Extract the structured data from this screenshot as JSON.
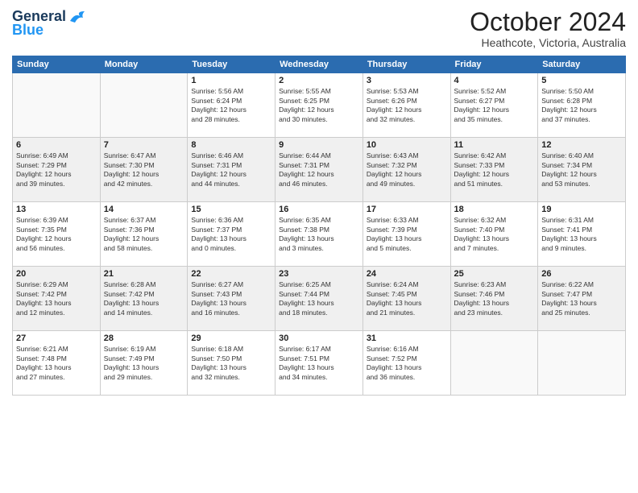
{
  "header": {
    "logo_general": "General",
    "logo_blue": "Blue",
    "month_title": "October 2024",
    "location": "Heathcote, Victoria, Australia"
  },
  "days_of_week": [
    "Sunday",
    "Monday",
    "Tuesday",
    "Wednesday",
    "Thursday",
    "Friday",
    "Saturday"
  ],
  "weeks": [
    [
      {
        "day": "",
        "info": ""
      },
      {
        "day": "",
        "info": ""
      },
      {
        "day": "1",
        "info": "Sunrise: 5:56 AM\nSunset: 6:24 PM\nDaylight: 12 hours\nand 28 minutes."
      },
      {
        "day": "2",
        "info": "Sunrise: 5:55 AM\nSunset: 6:25 PM\nDaylight: 12 hours\nand 30 minutes."
      },
      {
        "day": "3",
        "info": "Sunrise: 5:53 AM\nSunset: 6:26 PM\nDaylight: 12 hours\nand 32 minutes."
      },
      {
        "day": "4",
        "info": "Sunrise: 5:52 AM\nSunset: 6:27 PM\nDaylight: 12 hours\nand 35 minutes."
      },
      {
        "day": "5",
        "info": "Sunrise: 5:50 AM\nSunset: 6:28 PM\nDaylight: 12 hours\nand 37 minutes."
      }
    ],
    [
      {
        "day": "6",
        "info": "Sunrise: 6:49 AM\nSunset: 7:29 PM\nDaylight: 12 hours\nand 39 minutes."
      },
      {
        "day": "7",
        "info": "Sunrise: 6:47 AM\nSunset: 7:30 PM\nDaylight: 12 hours\nand 42 minutes."
      },
      {
        "day": "8",
        "info": "Sunrise: 6:46 AM\nSunset: 7:31 PM\nDaylight: 12 hours\nand 44 minutes."
      },
      {
        "day": "9",
        "info": "Sunrise: 6:44 AM\nSunset: 7:31 PM\nDaylight: 12 hours\nand 46 minutes."
      },
      {
        "day": "10",
        "info": "Sunrise: 6:43 AM\nSunset: 7:32 PM\nDaylight: 12 hours\nand 49 minutes."
      },
      {
        "day": "11",
        "info": "Sunrise: 6:42 AM\nSunset: 7:33 PM\nDaylight: 12 hours\nand 51 minutes."
      },
      {
        "day": "12",
        "info": "Sunrise: 6:40 AM\nSunset: 7:34 PM\nDaylight: 12 hours\nand 53 minutes."
      }
    ],
    [
      {
        "day": "13",
        "info": "Sunrise: 6:39 AM\nSunset: 7:35 PM\nDaylight: 12 hours\nand 56 minutes."
      },
      {
        "day": "14",
        "info": "Sunrise: 6:37 AM\nSunset: 7:36 PM\nDaylight: 12 hours\nand 58 minutes."
      },
      {
        "day": "15",
        "info": "Sunrise: 6:36 AM\nSunset: 7:37 PM\nDaylight: 13 hours\nand 0 minutes."
      },
      {
        "day": "16",
        "info": "Sunrise: 6:35 AM\nSunset: 7:38 PM\nDaylight: 13 hours\nand 3 minutes."
      },
      {
        "day": "17",
        "info": "Sunrise: 6:33 AM\nSunset: 7:39 PM\nDaylight: 13 hours\nand 5 minutes."
      },
      {
        "day": "18",
        "info": "Sunrise: 6:32 AM\nSunset: 7:40 PM\nDaylight: 13 hours\nand 7 minutes."
      },
      {
        "day": "19",
        "info": "Sunrise: 6:31 AM\nSunset: 7:41 PM\nDaylight: 13 hours\nand 9 minutes."
      }
    ],
    [
      {
        "day": "20",
        "info": "Sunrise: 6:29 AM\nSunset: 7:42 PM\nDaylight: 13 hours\nand 12 minutes."
      },
      {
        "day": "21",
        "info": "Sunrise: 6:28 AM\nSunset: 7:42 PM\nDaylight: 13 hours\nand 14 minutes."
      },
      {
        "day": "22",
        "info": "Sunrise: 6:27 AM\nSunset: 7:43 PM\nDaylight: 13 hours\nand 16 minutes."
      },
      {
        "day": "23",
        "info": "Sunrise: 6:25 AM\nSunset: 7:44 PM\nDaylight: 13 hours\nand 18 minutes."
      },
      {
        "day": "24",
        "info": "Sunrise: 6:24 AM\nSunset: 7:45 PM\nDaylight: 13 hours\nand 21 minutes."
      },
      {
        "day": "25",
        "info": "Sunrise: 6:23 AM\nSunset: 7:46 PM\nDaylight: 13 hours\nand 23 minutes."
      },
      {
        "day": "26",
        "info": "Sunrise: 6:22 AM\nSunset: 7:47 PM\nDaylight: 13 hours\nand 25 minutes."
      }
    ],
    [
      {
        "day": "27",
        "info": "Sunrise: 6:21 AM\nSunset: 7:48 PM\nDaylight: 13 hours\nand 27 minutes."
      },
      {
        "day": "28",
        "info": "Sunrise: 6:19 AM\nSunset: 7:49 PM\nDaylight: 13 hours\nand 29 minutes."
      },
      {
        "day": "29",
        "info": "Sunrise: 6:18 AM\nSunset: 7:50 PM\nDaylight: 13 hours\nand 32 minutes."
      },
      {
        "day": "30",
        "info": "Sunrise: 6:17 AM\nSunset: 7:51 PM\nDaylight: 13 hours\nand 34 minutes."
      },
      {
        "day": "31",
        "info": "Sunrise: 6:16 AM\nSunset: 7:52 PM\nDaylight: 13 hours\nand 36 minutes."
      },
      {
        "day": "",
        "info": ""
      },
      {
        "day": "",
        "info": ""
      }
    ]
  ]
}
